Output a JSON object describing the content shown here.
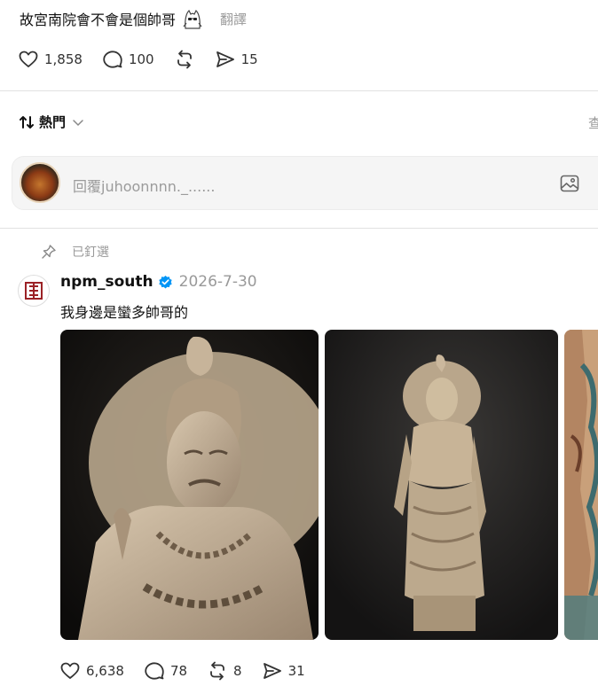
{
  "post": {
    "text": "故宮南院會不會是個帥哥",
    "emoji_icon": "bear-sunglasses-emoji-icon",
    "translate_label": "翻譯",
    "stats": {
      "likes": "1,858",
      "comments": "100",
      "reposts": "",
      "shares": "15"
    }
  },
  "sort": {
    "label": "熱門",
    "right_label": "查"
  },
  "reply_box": {
    "placeholder": "回覆juhoonnnn._......"
  },
  "comment": {
    "pinned_label": "已釘選",
    "author": "npm_south",
    "verified": true,
    "date": "2026-7-30",
    "text": "我身邊是蠻多帥哥的",
    "images": [
      "buddha-statue-closeup-photo",
      "buddha-statue-fullbody-photo",
      "painted-mural-photo"
    ],
    "stats": {
      "likes": "6,638",
      "comments": "78",
      "reposts": "8",
      "shares": "31"
    }
  },
  "colors": {
    "verified_blue": "#0095f6",
    "muted_text": "#999999",
    "divider": "#e1e1e1",
    "logo_red": "#9b2226"
  }
}
